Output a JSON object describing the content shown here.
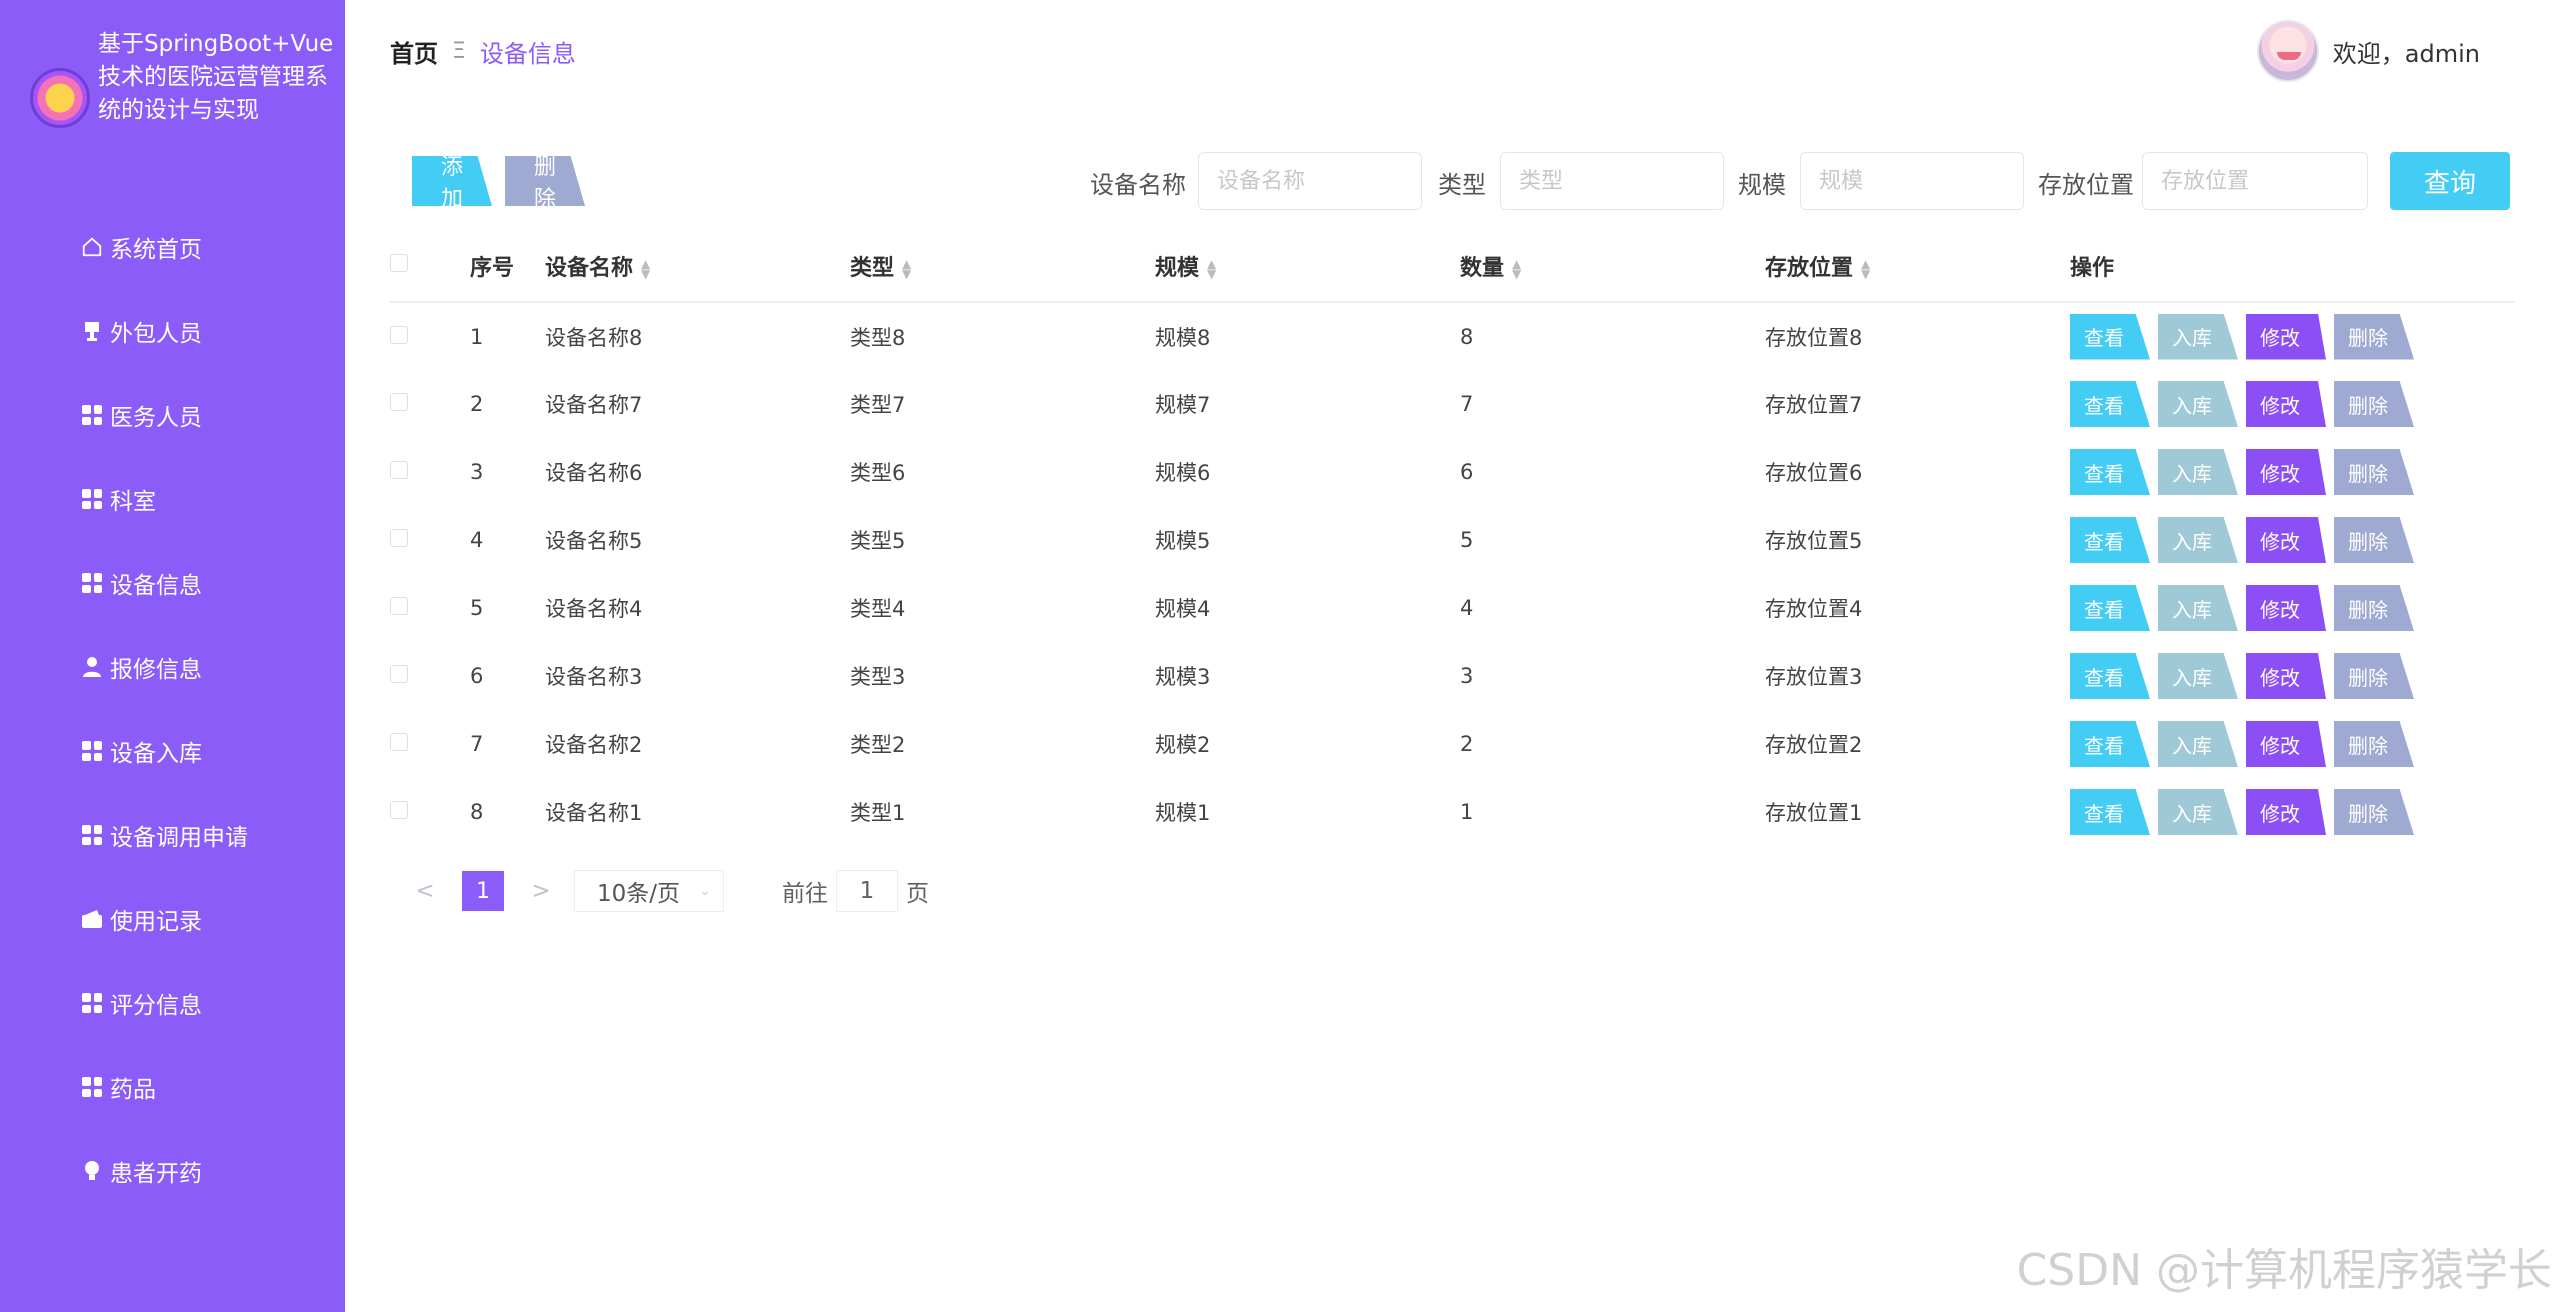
{
  "sidebar": {
    "title": "基于SpringBoot+Vue技术的医院运营管理系统的设计与实现",
    "items": [
      {
        "label": "系统首页",
        "icon": "home-icon"
      },
      {
        "label": "外包人员",
        "icon": "cup-icon"
      },
      {
        "label": "医务人员",
        "icon": "grid-icon"
      },
      {
        "label": "科室",
        "icon": "grid-icon"
      },
      {
        "label": "设备信息",
        "icon": "grid-icon"
      },
      {
        "label": "报修信息",
        "icon": "user-icon"
      },
      {
        "label": "设备入库",
        "icon": "grid-icon"
      },
      {
        "label": "设备调用申请",
        "icon": "grid-icon"
      },
      {
        "label": "使用记录",
        "icon": "wallet-icon"
      },
      {
        "label": "评分信息",
        "icon": "grid-icon"
      },
      {
        "label": "药品",
        "icon": "grid-icon"
      },
      {
        "label": "患者开药",
        "icon": "bulb-icon"
      }
    ]
  },
  "header": {
    "breadcrumb_home": "首页",
    "breadcrumb_sep": "Ξ",
    "breadcrumb_current": "设备信息",
    "greeting": "欢迎，admin"
  },
  "toolbar": {
    "add_label": "添加",
    "delete_label": "删除",
    "name_label": "设备名称",
    "name_placeholder": "设备名称",
    "type_label": "类型",
    "type_placeholder": "类型",
    "scale_label": "规模",
    "scale_placeholder": "规模",
    "location_label": "存放位置",
    "location_placeholder": "存放位置",
    "query_label": "查询"
  },
  "table": {
    "headers": [
      "序号",
      "设备名称",
      "类型",
      "规模",
      "数量",
      "存放位置",
      "操作"
    ],
    "rows": [
      [
        "1",
        "设备名称8",
        "类型8",
        "规模8",
        "8",
        "存放位置8"
      ],
      [
        "2",
        "设备名称7",
        "类型7",
        "规模7",
        "7",
        "存放位置7"
      ],
      [
        "3",
        "设备名称6",
        "类型6",
        "规模6",
        "6",
        "存放位置6"
      ],
      [
        "4",
        "设备名称5",
        "类型5",
        "规模5",
        "5",
        "存放位置5"
      ],
      [
        "5",
        "设备名称4",
        "类型4",
        "规模4",
        "4",
        "存放位置4"
      ],
      [
        "6",
        "设备名称3",
        "类型3",
        "规模3",
        "3",
        "存放位置3"
      ],
      [
        "7",
        "设备名称2",
        "类型2",
        "规模2",
        "2",
        "存放位置2"
      ],
      [
        "8",
        "设备名称1",
        "类型1",
        "规模1",
        "1",
        "存放位置1"
      ]
    ],
    "op_labels": {
      "view": "查看",
      "in": "入库",
      "edit": "修改",
      "del": "删除"
    }
  },
  "pagination": {
    "prev": "<",
    "next": ">",
    "current_page": "1",
    "page_size": "10条/页",
    "goto_label": "前往",
    "goto_value": "1",
    "page_suffix": "页"
  },
  "watermark": "CSDN @计算机程序猿学长",
  "colors": {
    "sidebar": "#8c5cf9",
    "accent_cyan": "#43cdf4",
    "edit_purple": "#8c4ff5",
    "delete_gray": "#9faad3",
    "in_gray": "#9fc9d6"
  }
}
